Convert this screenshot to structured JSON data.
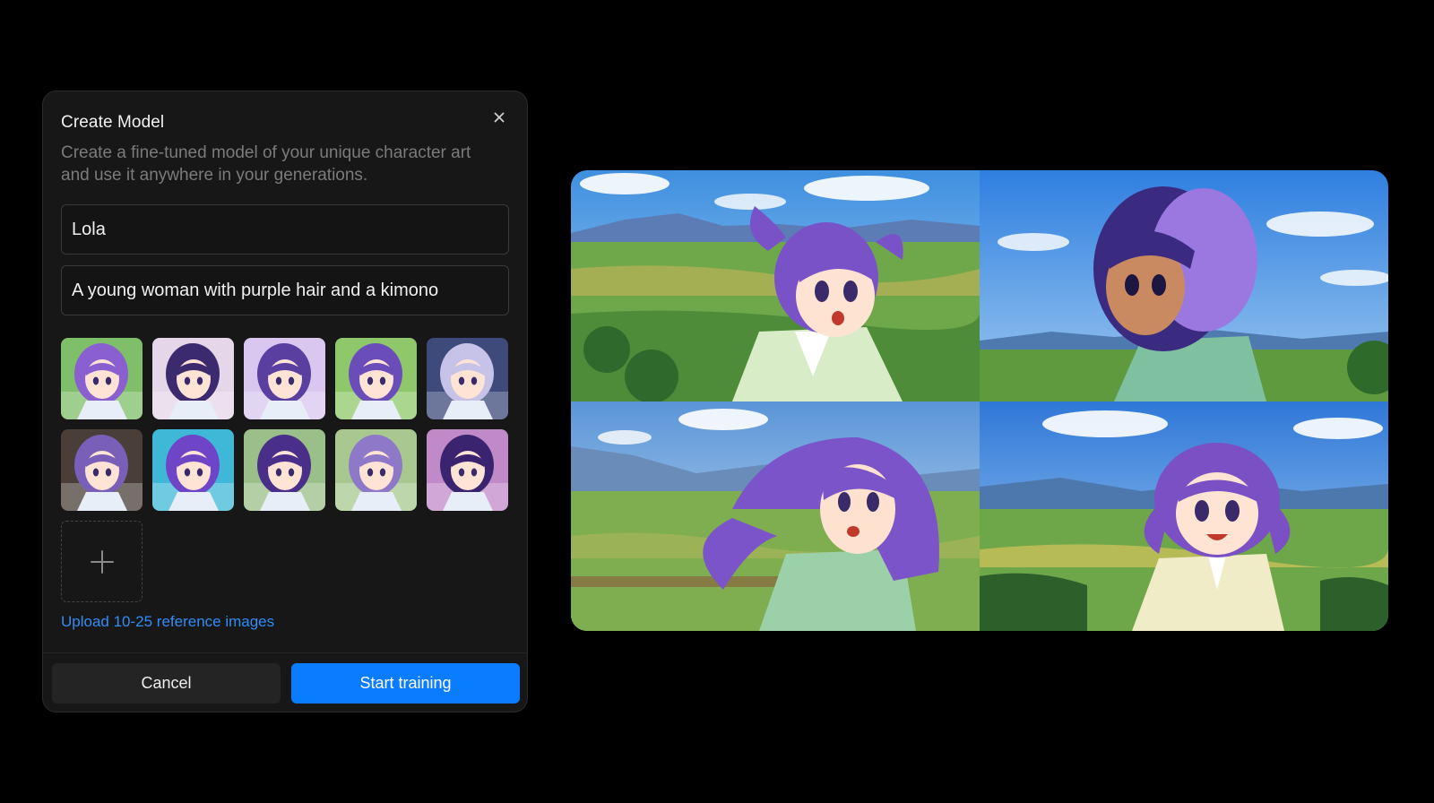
{
  "dialog": {
    "title": "Create Model",
    "close_icon": "close-icon",
    "description": "Create a fine-tuned model of your unique character art and use it anywhere in your generations.",
    "name_value": "Lola",
    "description_value": "A young woman with purple hair and a kimono",
    "reference_thumbnails": [
      {
        "bg": "#7fbf6a",
        "accent": "#8a5fd0"
      },
      {
        "bg": "#e6d6ea",
        "accent": "#3b2a6e"
      },
      {
        "bg": "#d9c7f0",
        "accent": "#5b3fa0"
      },
      {
        "bg": "#8fc86a",
        "accent": "#6a4db8"
      },
      {
        "bg": "#3d4a7a",
        "accent": "#c6c2e8"
      },
      {
        "bg": "#4a3f38",
        "accent": "#7a5fb8"
      },
      {
        "bg": "#3fb8d8",
        "accent": "#6f45c8"
      },
      {
        "bg": "#9bbf88",
        "accent": "#4a2f8a"
      },
      {
        "bg": "#a8c890",
        "accent": "#8e78c8"
      },
      {
        "bg": "#c08ac8",
        "accent": "#3a2470"
      }
    ],
    "add_icon": "plus-icon",
    "upload_hint": "Upload 10-25 reference images",
    "cancel_label": "Cancel",
    "start_label": "Start training"
  },
  "colors": {
    "accent": "#0a7cff",
    "link": "#2f8df6",
    "dialog_bg": "#171717"
  },
  "preview": {
    "images": [
      {
        "subject": "girl-purple-hair-light-kimono-countryside"
      },
      {
        "subject": "girl-dark-purple-hair-green-kimono-sky"
      },
      {
        "subject": "girl-long-purple-hair-green-kimono-village"
      },
      {
        "subject": "girl-purple-hair-cream-kimono-valley"
      }
    ]
  }
}
